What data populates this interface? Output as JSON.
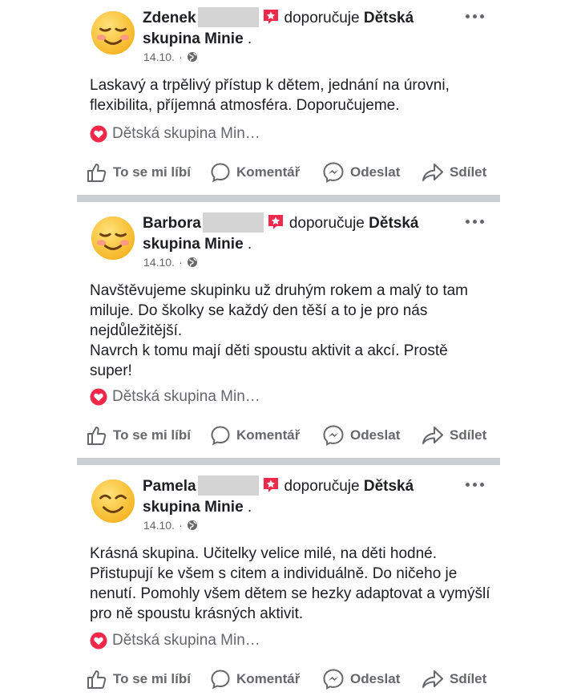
{
  "posts": [
    {
      "name": "Zdenek",
      "recommends": "doporučuje",
      "page_line1": "Dětská",
      "page_line2": "skupina Minie",
      "period": " .",
      "date": "14.10.",
      "dot": "·",
      "text": "Laskavý a trpělivý přístup k dětem, jednání na úrovni, flexibilita, příjemná atmosféra. Doporučujeme.",
      "page_tag": "Dětská skupina Min…"
    },
    {
      "name": "Barbora",
      "recommends": "doporučuje",
      "page_line1": "Dětská",
      "page_line2": "skupina Minie",
      "period": " .",
      "date": "14.10.",
      "dot": "·",
      "text": "Navštěvujeme skupinku už druhým rokem a malý to tam miluje. Do školky se každý den těší a to je pro nás nejdůležitější.\nNavrch k tomu mají děti spoustu aktivit a akcí. Prostě super!",
      "page_tag": "Dětská skupina Min…"
    },
    {
      "name": "Pamela",
      "recommends": "doporučuje",
      "page_line1": "Dětská",
      "page_line2": "skupina Minie",
      "period": " .",
      "date": "14.10.",
      "dot": "·",
      "text": "Krásná skupina. Učitelky velice milé, na děti hodné. Přistupují ke všem s citem a individuálně. Do ničeho je nenutí. Pomohly všem dětem se hezky adaptovat a vymýšlí pro ně spoustu krásných aktivit.",
      "page_tag": "Dětská skupina Min…"
    }
  ],
  "actions": {
    "like": "To se mi líbí",
    "comment": "Komentář",
    "send": "Odeslat",
    "share": "Sdílet"
  },
  "icons": {
    "avatar_1": "smiling-blush-face-emoji",
    "avatar_2": "smiling-blush-face-emoji",
    "avatar_3": "smiling-face-emoji",
    "recommend": "recommend-star-icon",
    "privacy": "globe-icon",
    "page_tag": "heart-icon",
    "like": "thumbs-up-icon",
    "comment": "comment-bubble-icon",
    "send": "messenger-icon",
    "share": "share-arrow-icon",
    "more": "more-dots-icon"
  },
  "colors": {
    "recommend_red": "#f0284a",
    "text": "#1c1e21",
    "muted": "#65676b",
    "separator": "#ccced2",
    "emoji_yellow": "#ffc83d",
    "blush": "#ff8f8f"
  }
}
